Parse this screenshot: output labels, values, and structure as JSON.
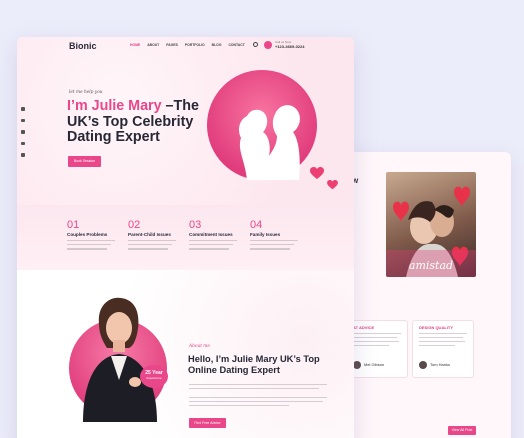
{
  "back_card": {
    "title": "w",
    "card1_title": "AT ADVICE",
    "card2_title": "DESIGN QUALITY",
    "card1_name": "Mel Gibson",
    "card2_name": "Tom Hanks",
    "view_all": "View All Post",
    "photo_caption": "amistad"
  },
  "header": {
    "logo": "Bionic",
    "nav": [
      "HOME",
      "ABOUT",
      "PAGES",
      "PORTFOLIO",
      "BLOG",
      "CONTACT"
    ],
    "call_label": "Call us Now",
    "phone": "+123-4669-0224"
  },
  "hero": {
    "tagline": "let me help you",
    "headline_pink": "I’m Julie Mary",
    "headline_rest": " –The UK’s Top Celebrity Dating Expert",
    "cta": "Book Session"
  },
  "stats": [
    {
      "num": "01",
      "title": "Couples Problems"
    },
    {
      "num": "02",
      "title": "Parent-Child Issues"
    },
    {
      "num": "03",
      "title": "Commitment Issues"
    },
    {
      "num": "04",
      "title": "Family Issues"
    }
  ],
  "about": {
    "tag": "About me",
    "title": "Hello, I’m Julie Mary UK’s Top Online Dating Expert",
    "badge_years": "25 Year",
    "badge_label": "Experience",
    "cta": "Find Free Advice"
  },
  "colors": {
    "accent": "#e9478a",
    "bg": "#ecedfa"
  }
}
